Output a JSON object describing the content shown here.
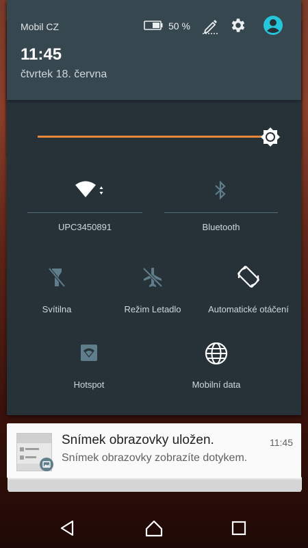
{
  "status": {
    "carrier": "Mobil CZ",
    "battery_percent": "50 %",
    "battery_level": 0.5
  },
  "header": {
    "time": "11:45",
    "date": "čtvrtek 18. června",
    "icons": [
      "battery-icon",
      "edit-icon",
      "settings-icon",
      "user-account-icon"
    ]
  },
  "brightness": {
    "level": 0.98
  },
  "tiles": {
    "wifi": {
      "label": "UPC3450891",
      "icon": "wifi-icon",
      "active": true
    },
    "bluetooth": {
      "label": "Bluetooth",
      "icon": "bluetooth-icon",
      "active": false
    },
    "flashlight": {
      "label": "Svítilna",
      "icon": "flashlight-off-icon",
      "active": false
    },
    "airplane": {
      "label": "Režim Letadlo",
      "icon": "airplane-icon",
      "active": false
    },
    "rotation": {
      "label": "Automatické otáčení",
      "icon": "auto-rotate-icon",
      "active": true
    },
    "hotspot": {
      "label": "Hotspot",
      "icon": "hotspot-icon",
      "active": false
    },
    "mobile_data": {
      "label": "Mobilní data",
      "icon": "globe-icon",
      "active": true
    }
  },
  "notification": {
    "title": "Snímek obrazovky uložen.",
    "text": "Snímek obrazovky zobrazíte dotykem.",
    "time": "11:45"
  },
  "nav": [
    "back-icon",
    "home-icon",
    "recents-icon"
  ],
  "colors": {
    "shade_bg": "#263238",
    "header_bg": "#37474f",
    "accent": "#e8873a",
    "account": "#26c6da"
  }
}
